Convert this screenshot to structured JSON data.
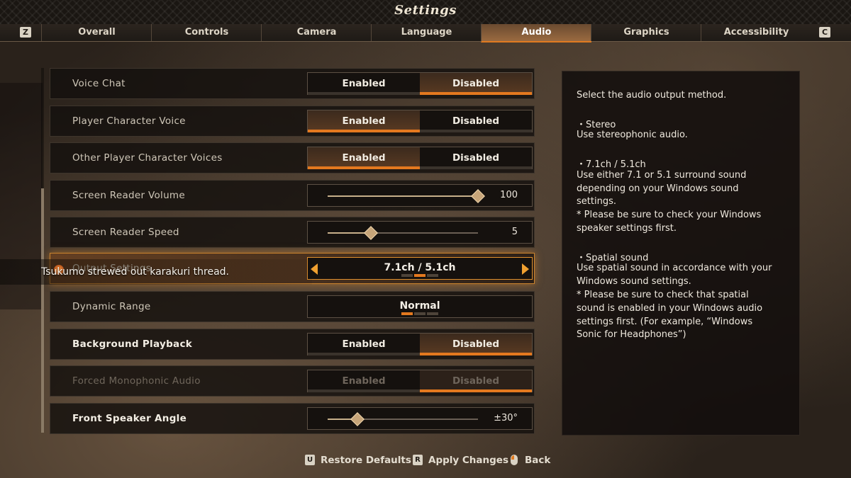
{
  "window": {
    "title": "Settings"
  },
  "tabs": {
    "prev_key": "Z",
    "next_key": "C",
    "items": [
      {
        "label": "Overall"
      },
      {
        "label": "Controls"
      },
      {
        "label": "Camera"
      },
      {
        "label": "Language"
      },
      {
        "label": "Audio",
        "active": true
      },
      {
        "label": "Graphics"
      },
      {
        "label": "Accessibility"
      }
    ]
  },
  "settings": [
    {
      "label": "Voice Chat",
      "type": "toggle",
      "options": [
        "Enabled",
        "Disabled"
      ],
      "selected": "Disabled"
    },
    {
      "label": "Player Character Voice",
      "type": "toggle",
      "options": [
        "Enabled",
        "Disabled"
      ],
      "selected": "Enabled"
    },
    {
      "label": "Other Player Character Voices",
      "type": "toggle",
      "options": [
        "Enabled",
        "Disabled"
      ],
      "selected": "Enabled"
    },
    {
      "label": "Screen Reader Volume",
      "type": "slider",
      "value": "100",
      "level": 1.0
    },
    {
      "label": "Screen Reader Speed",
      "type": "slider",
      "value": "5",
      "level": 0.29
    },
    {
      "label": "Output Settings",
      "type": "selector",
      "value": "7.1ch / 5.1ch",
      "option_count": 3,
      "option_index": 1
    },
    {
      "label": "Dynamic Range",
      "type": "selector",
      "value": "Normal",
      "option_count": 3,
      "option_index": 0
    },
    {
      "label": "Background Playback",
      "type": "toggle",
      "options": [
        "Enabled",
        "Disabled"
      ],
      "selected": "Disabled"
    },
    {
      "label": "Forced Monophonic Audio",
      "type": "toggle",
      "options": [
        "Enabled",
        "Disabled"
      ],
      "selected": "Disabled",
      "disabled": true
    },
    {
      "label": "Front Speaker Angle",
      "type": "slider",
      "value": "±30°",
      "level": 0.2
    }
  ],
  "notification": {
    "text": "Tsukumo strewed out karakuri thread."
  },
  "description": {
    "lines": [
      "Select the audio output method.",
      "",
      "・Stereo",
      "Use stereophonic audio.",
      "",
      "・7.1ch / 5.1ch",
      "Use either 7.1 or 5.1 surround sound",
      "depending on your Windows sound",
      "settings.",
      "* Please be sure to check your Windows",
      "speaker settings first.",
      "",
      "・Spatial sound",
      "Use spatial sound in accordance with your",
      "Windows sound settings.",
      "* Please be sure to check that spatial",
      "sound is enabled in your Windows audio",
      "settings first. (For example, “Windows",
      "Sonic for Headphones”)"
    ]
  },
  "footer": {
    "restore": {
      "key": "U",
      "label": "Restore Defaults"
    },
    "apply": {
      "key": "R",
      "label": "Apply Changes"
    },
    "back": {
      "label": "Back"
    }
  },
  "colors": {
    "accent": "#e4791f",
    "panel": "#15110e"
  }
}
